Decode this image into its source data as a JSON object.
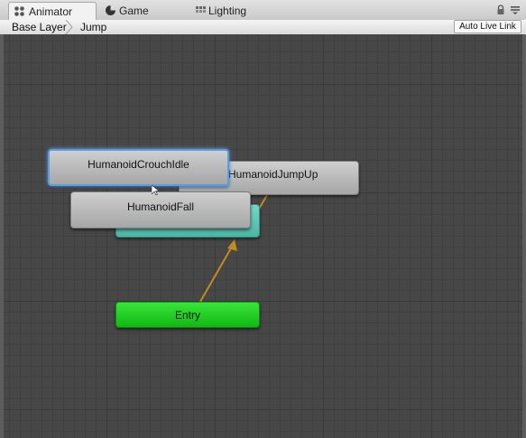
{
  "tabs": [
    {
      "label": "Animator",
      "icon": "animator-icon",
      "active": true
    },
    {
      "label": "Game",
      "icon": "game-icon",
      "active": false
    },
    {
      "label": "Lighting",
      "icon": "lighting-icon",
      "active": false
    }
  ],
  "controls": {
    "lock_icon": "lock-icon",
    "menu_icon": "menu-icon"
  },
  "breadcrumb": [
    "Base Layer",
    "Jump"
  ],
  "auto_live_link": "Auto Live Link",
  "states": {
    "crouch_idle": "HumanoidCrouchIdle",
    "jump_up": "HumanoidJumpUp",
    "fall": "HumanoidFall",
    "entry": "Entry"
  },
  "colors": {
    "default_state": "#cfcfcf",
    "teal_state": "#5cc7b4",
    "entry_state": "#1ed11f",
    "selection": "#5a9de6",
    "transition": "#c58a1e",
    "canvas": "#474747"
  }
}
